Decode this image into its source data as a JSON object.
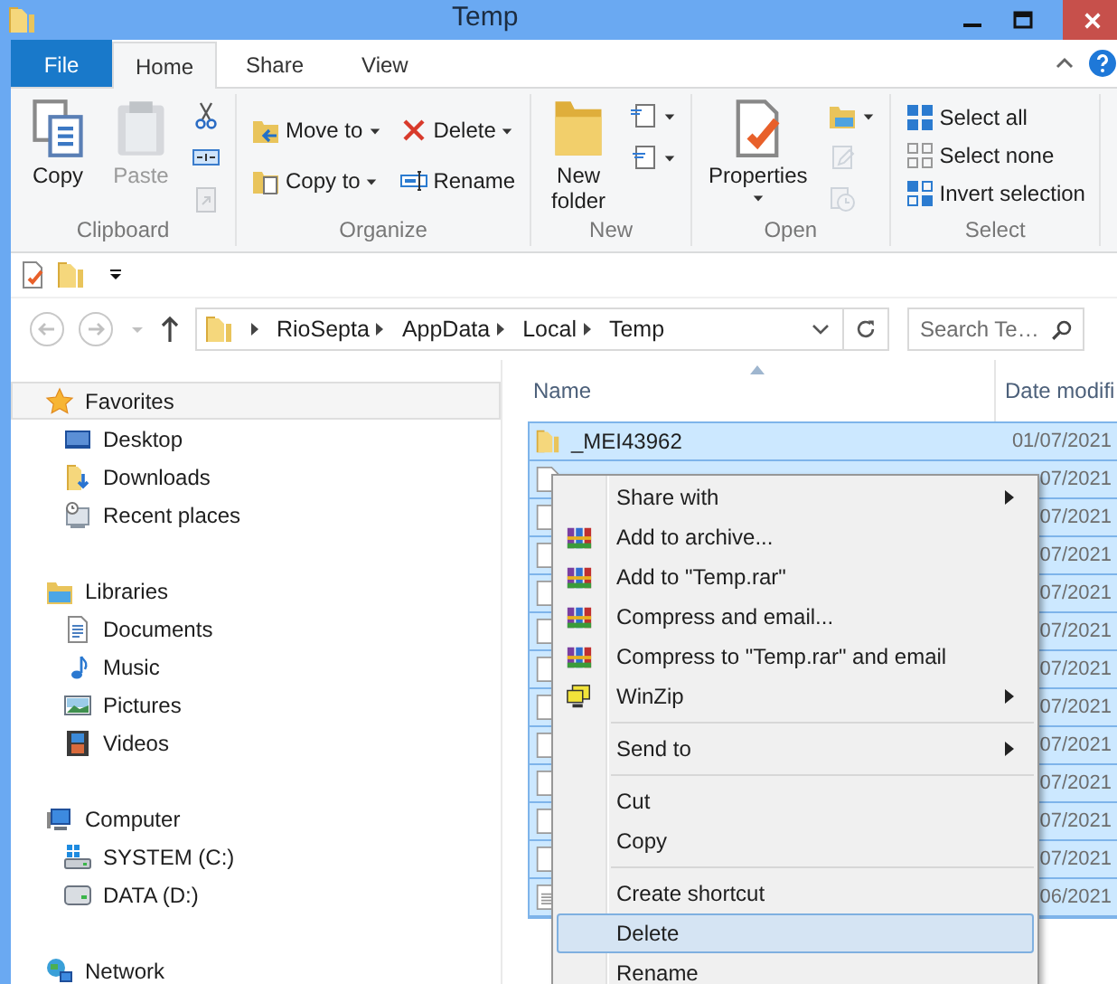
{
  "window": {
    "title": "Temp"
  },
  "ribbon_tabs": [
    {
      "label": "File",
      "kind": "file",
      "selected": false
    },
    {
      "label": "Home",
      "kind": "tab",
      "selected": true
    },
    {
      "label": "Share",
      "kind": "tab",
      "selected": false
    },
    {
      "label": "View",
      "kind": "tab",
      "selected": false
    }
  ],
  "ribbon_groups": [
    {
      "label": "Clipboard",
      "columns": [
        [
          {
            "kind": "copy",
            "label": "Copy",
            "disabled": false,
            "dropdown": false
          }
        ],
        [
          {
            "kind": "paste",
            "label": "Paste",
            "disabled": true,
            "dropdown": false
          }
        ],
        [
          {
            "kind": "cut",
            "disabled": false,
            "dropdown": false
          },
          {
            "kind": "copy-path",
            "disabled": false,
            "dropdown": false
          },
          {
            "kind": "paste-shortcut",
            "disabled": true,
            "dropdown": false
          }
        ]
      ]
    },
    {
      "label": "Organize",
      "columns": [
        [
          {
            "kind": "move-to",
            "label": "Move to",
            "disabled": false,
            "dropdown": true
          },
          {
            "kind": "copy-to",
            "label": "Copy to",
            "disabled": false,
            "dropdown": true
          }
        ],
        [
          {
            "kind": "delete",
            "label": "Delete",
            "disabled": false,
            "dropdown": true
          },
          {
            "kind": "rename",
            "label": "Rename",
            "disabled": false,
            "dropdown": false
          }
        ]
      ]
    },
    {
      "label": "New",
      "columns": [
        [
          {
            "kind": "new-folder",
            "label": "New folder",
            "disabled": false,
            "dropdown": false
          }
        ],
        [
          {
            "kind": "new-item",
            "disabled": false,
            "dropdown": true
          },
          {
            "kind": "easy-access",
            "disabled": false,
            "dropdown": true
          }
        ]
      ]
    },
    {
      "label": "Open",
      "columns": [
        [
          {
            "kind": "properties",
            "label": "Properties",
            "disabled": false,
            "dropdown": true
          }
        ],
        [
          {
            "kind": "open",
            "disabled": false,
            "dropdown": true
          },
          {
            "kind": "edit",
            "disabled": true,
            "dropdown": false
          },
          {
            "kind": "history",
            "disabled": true,
            "dropdown": false
          }
        ]
      ]
    },
    {
      "label": "Select",
      "columns": [
        [
          {
            "kind": "select-all",
            "label": "Select all",
            "disabled": false,
            "dropdown": false
          },
          {
            "kind": "select-none",
            "label": "Select none",
            "disabled": false,
            "dropdown": false
          },
          {
            "kind": "invert",
            "label": "Invert selection",
            "disabled": false,
            "dropdown": false
          }
        ]
      ]
    }
  ],
  "address": {
    "breadcrumbs": [
      "RioSepta",
      "AppData",
      "Local",
      "Temp"
    ],
    "search_placeholder": "Search Te…"
  },
  "navigation": [
    {
      "label": "Favorites",
      "kind": "star",
      "selected": true,
      "children": [
        {
          "label": "Desktop",
          "kind": "desktop",
          "selected": false
        },
        {
          "label": "Downloads",
          "kind": "downloads",
          "selected": false
        },
        {
          "label": "Recent places",
          "kind": "recent",
          "selected": false
        }
      ]
    },
    {
      "label": "Libraries",
      "kind": "libraries",
      "selected": false,
      "children": [
        {
          "label": "Documents",
          "kind": "documents",
          "selected": false
        },
        {
          "label": "Music",
          "kind": "music",
          "selected": false
        },
        {
          "label": "Pictures",
          "kind": "pictures",
          "selected": false
        },
        {
          "label": "Videos",
          "kind": "videos",
          "selected": false
        }
      ]
    },
    {
      "label": "Computer",
      "kind": "computer",
      "selected": false,
      "children": [
        {
          "label": "SYSTEM (C:)",
          "kind": "drive-c",
          "selected": false
        },
        {
          "label": "DATA (D:)",
          "kind": "drive-d",
          "selected": false
        }
      ]
    },
    {
      "label": "Network",
      "kind": "network",
      "selected": false
    }
  ],
  "file_list": {
    "columns": [
      "Name",
      "Date modifi"
    ],
    "rows": [
      {
        "name": "_MEI43962",
        "date": "01/07/2021",
        "kind": "folder",
        "selected": true
      },
      {
        "date": "07/2021",
        "kind": "file",
        "selected": true
      },
      {
        "date": "07/2021",
        "kind": "file",
        "selected": true
      },
      {
        "date": "07/2021",
        "kind": "file",
        "selected": true
      },
      {
        "date": "07/2021",
        "kind": "file",
        "selected": true
      },
      {
        "date": "07/2021",
        "kind": "file",
        "selected": true
      },
      {
        "date": "07/2021",
        "kind": "file",
        "selected": true
      },
      {
        "date": "07/2021",
        "kind": "file",
        "selected": true
      },
      {
        "date": "07/2021",
        "kind": "file",
        "selected": true
      },
      {
        "date": "07/2021",
        "kind": "file",
        "selected": true
      },
      {
        "date": "07/2021",
        "kind": "file",
        "selected": true
      },
      {
        "date": "07/2021",
        "kind": "file",
        "selected": true
      },
      {
        "date": "06/2021",
        "kind": "document",
        "selected": true
      }
    ]
  },
  "context_menu": {
    "groups": [
      [
        {
          "label": "Share with",
          "kind": "plain",
          "submenu": true,
          "selected": false
        },
        {
          "label": "Add to archive...",
          "kind": "archive",
          "submenu": false,
          "selected": false
        },
        {
          "label": "Add to \"Temp.rar\"",
          "kind": "archive",
          "submenu": false,
          "selected": false
        },
        {
          "label": "Compress and email...",
          "kind": "archive",
          "submenu": false,
          "selected": false
        },
        {
          "label": "Compress to \"Temp.rar\" and email",
          "kind": "archive",
          "submenu": false,
          "selected": false
        },
        {
          "label": "WinZip",
          "kind": "winzip",
          "submenu": true,
          "selected": false
        }
      ],
      [
        {
          "label": "Send to",
          "kind": "plain",
          "submenu": true,
          "selected": false
        }
      ],
      [
        {
          "label": "Cut",
          "kind": "plain",
          "submenu": false,
          "selected": false
        },
        {
          "label": "Copy",
          "kind": "plain",
          "submenu": false,
          "selected": false
        }
      ],
      [
        {
          "label": "Create shortcut",
          "kind": "plain",
          "submenu": false,
          "selected": false
        },
        {
          "label": "Delete",
          "kind": "plain",
          "submenu": false,
          "selected": true
        },
        {
          "label": "Rename",
          "kind": "plain",
          "submenu": false,
          "selected": false
        }
      ]
    ]
  }
}
